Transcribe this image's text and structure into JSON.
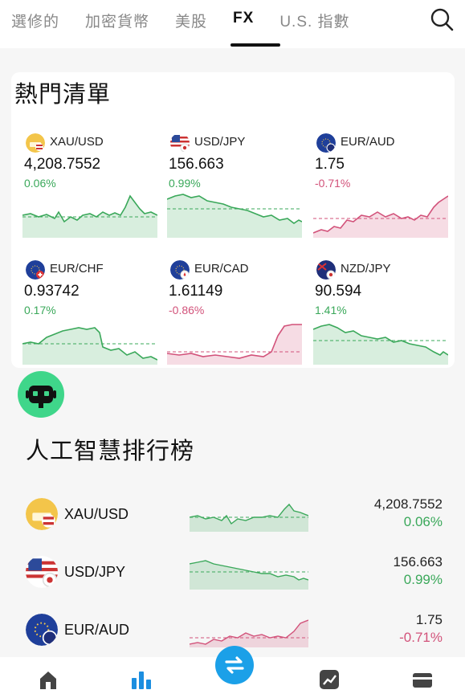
{
  "tabs": [
    {
      "label": "選修的",
      "active": false
    },
    {
      "label": "加密貨幣",
      "active": false
    },
    {
      "label": "美股",
      "active": false
    },
    {
      "label": "FX",
      "active": true
    },
    {
      "label": "U.S. 指數",
      "active": false
    }
  ],
  "search_icon": "search-icon",
  "hot_list": {
    "title": "熱門清單",
    "tiles": [
      {
        "symbol": "XAU/USD",
        "price": "4,208.7552",
        "change": "0.06%",
        "direction": "up",
        "icon": "gold-usd-icon"
      },
      {
        "symbol": "USD/JPY",
        "price": "156.663",
        "change": "0.99%",
        "direction": "up",
        "icon": "usd-jpy-flag-icon"
      },
      {
        "symbol": "EUR/AUD",
        "price": "1.75",
        "change": "-0.71%",
        "direction": "down",
        "icon": "eur-aud-flag-icon"
      },
      {
        "symbol": "EUR/CHF",
        "price": "0.93742",
        "change": "0.17%",
        "direction": "up",
        "icon": "eur-chf-flag-icon"
      },
      {
        "symbol": "EUR/CAD",
        "price": "1.61149",
        "change": "-0.86%",
        "direction": "down",
        "icon": "eur-cad-flag-icon"
      },
      {
        "symbol": "NZD/JPY",
        "price": "90.594",
        "change": "1.41%",
        "direction": "up",
        "icon": "nzd-jpy-flag-icon"
      }
    ]
  },
  "bot_icon": "robot-icon",
  "ai_ranking": {
    "title": "人工智慧排行榜",
    "rows": [
      {
        "symbol": "XAU/USD",
        "price": "4,208.7552",
        "change": "0.06%",
        "direction": "up"
      },
      {
        "symbol": "USD/JPY",
        "price": "156.663",
        "change": "0.99%",
        "direction": "up"
      },
      {
        "symbol": "EUR/AUD",
        "price": "1.75",
        "change": "-0.71%",
        "direction": "down"
      }
    ]
  },
  "bottom_nav": [
    {
      "icon": "home-icon",
      "active": false
    },
    {
      "icon": "market-bars-icon",
      "active": true
    },
    {
      "icon": "exchange-icon",
      "active": false
    },
    {
      "icon": "trend-chart-icon",
      "active": false
    },
    {
      "icon": "wallet-icon",
      "active": false
    }
  ],
  "colors": {
    "up": "#3aa85a",
    "down": "#d2527a",
    "accent": "#1ba0e8",
    "bot": "#3fd68a"
  }
}
